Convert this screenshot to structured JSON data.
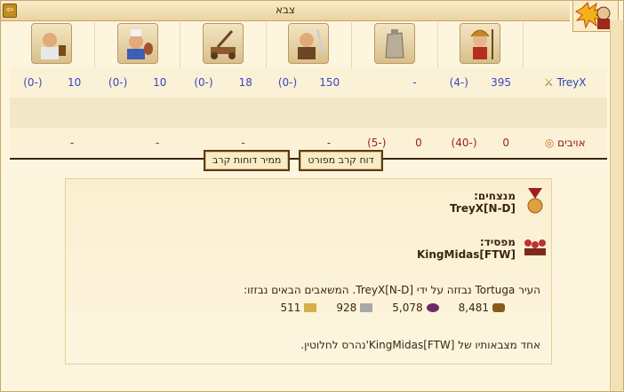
{
  "window": {
    "title": "צבא",
    "exit_glyph": "⇦"
  },
  "units": [
    {
      "name": "spearman",
      "icon": "hoplite-unit-icon",
      "own_count": "395",
      "own_loss": "(-4)",
      "enemy_count": "0",
      "enemy_loss": "(-40)"
    },
    {
      "name": "wall",
      "icon": "wall-unit-icon",
      "own_count": "-",
      "own_loss": "",
      "enemy_count": "0",
      "enemy_loss": "(-5)"
    },
    {
      "name": "swordsman",
      "icon": "swordsman-unit-icon",
      "own_count": "150",
      "own_loss": "(-0)",
      "enemy_count": "-",
      "enemy_loss": ""
    },
    {
      "name": "catapult",
      "icon": "catapult-unit-icon",
      "own_count": "18",
      "own_loss": "(-0)",
      "enemy_count": "-",
      "enemy_loss": ""
    },
    {
      "name": "cook",
      "icon": "cook-unit-icon",
      "own_count": "10",
      "own_loss": "(-0)",
      "enemy_count": "-",
      "enemy_loss": ""
    },
    {
      "name": "doctor",
      "icon": "doctor-unit-icon",
      "own_count": "10",
      "own_loss": "(-0)",
      "enemy_count": "-",
      "enemy_loss": ""
    }
  ],
  "rows": {
    "own_label": "TreyX",
    "enemy_label": "אויבים"
  },
  "buttons": {
    "detailed": "דוח קרב מפורט",
    "convert": "ממיר דוחות קרב"
  },
  "report": {
    "winners_label": "מנצחים:",
    "winners_name": "TreyX[N-D]",
    "losers_label": "מפסיד:",
    "losers_name": "KingMidas[FTW]",
    "plunder_text": "העיר Tortuga נבזזה על ידי TreyX[N-D]. המשאבים הבאים נבזזו:",
    "resources": [
      {
        "icon": "wood-icon",
        "value": "8,481"
      },
      {
        "icon": "wine-icon",
        "value": "5,078"
      },
      {
        "icon": "marble-icon",
        "value": "928"
      },
      {
        "icon": "crystal-icon",
        "value": "511"
      }
    ],
    "destroyed_text": "אחד מצבאותיו של KingMidas[FTW]'נהרס לחלוטין."
  },
  "colors": {
    "own": "#3a46c8",
    "enemy": "#9b2121",
    "background": "#fdf5dd"
  }
}
